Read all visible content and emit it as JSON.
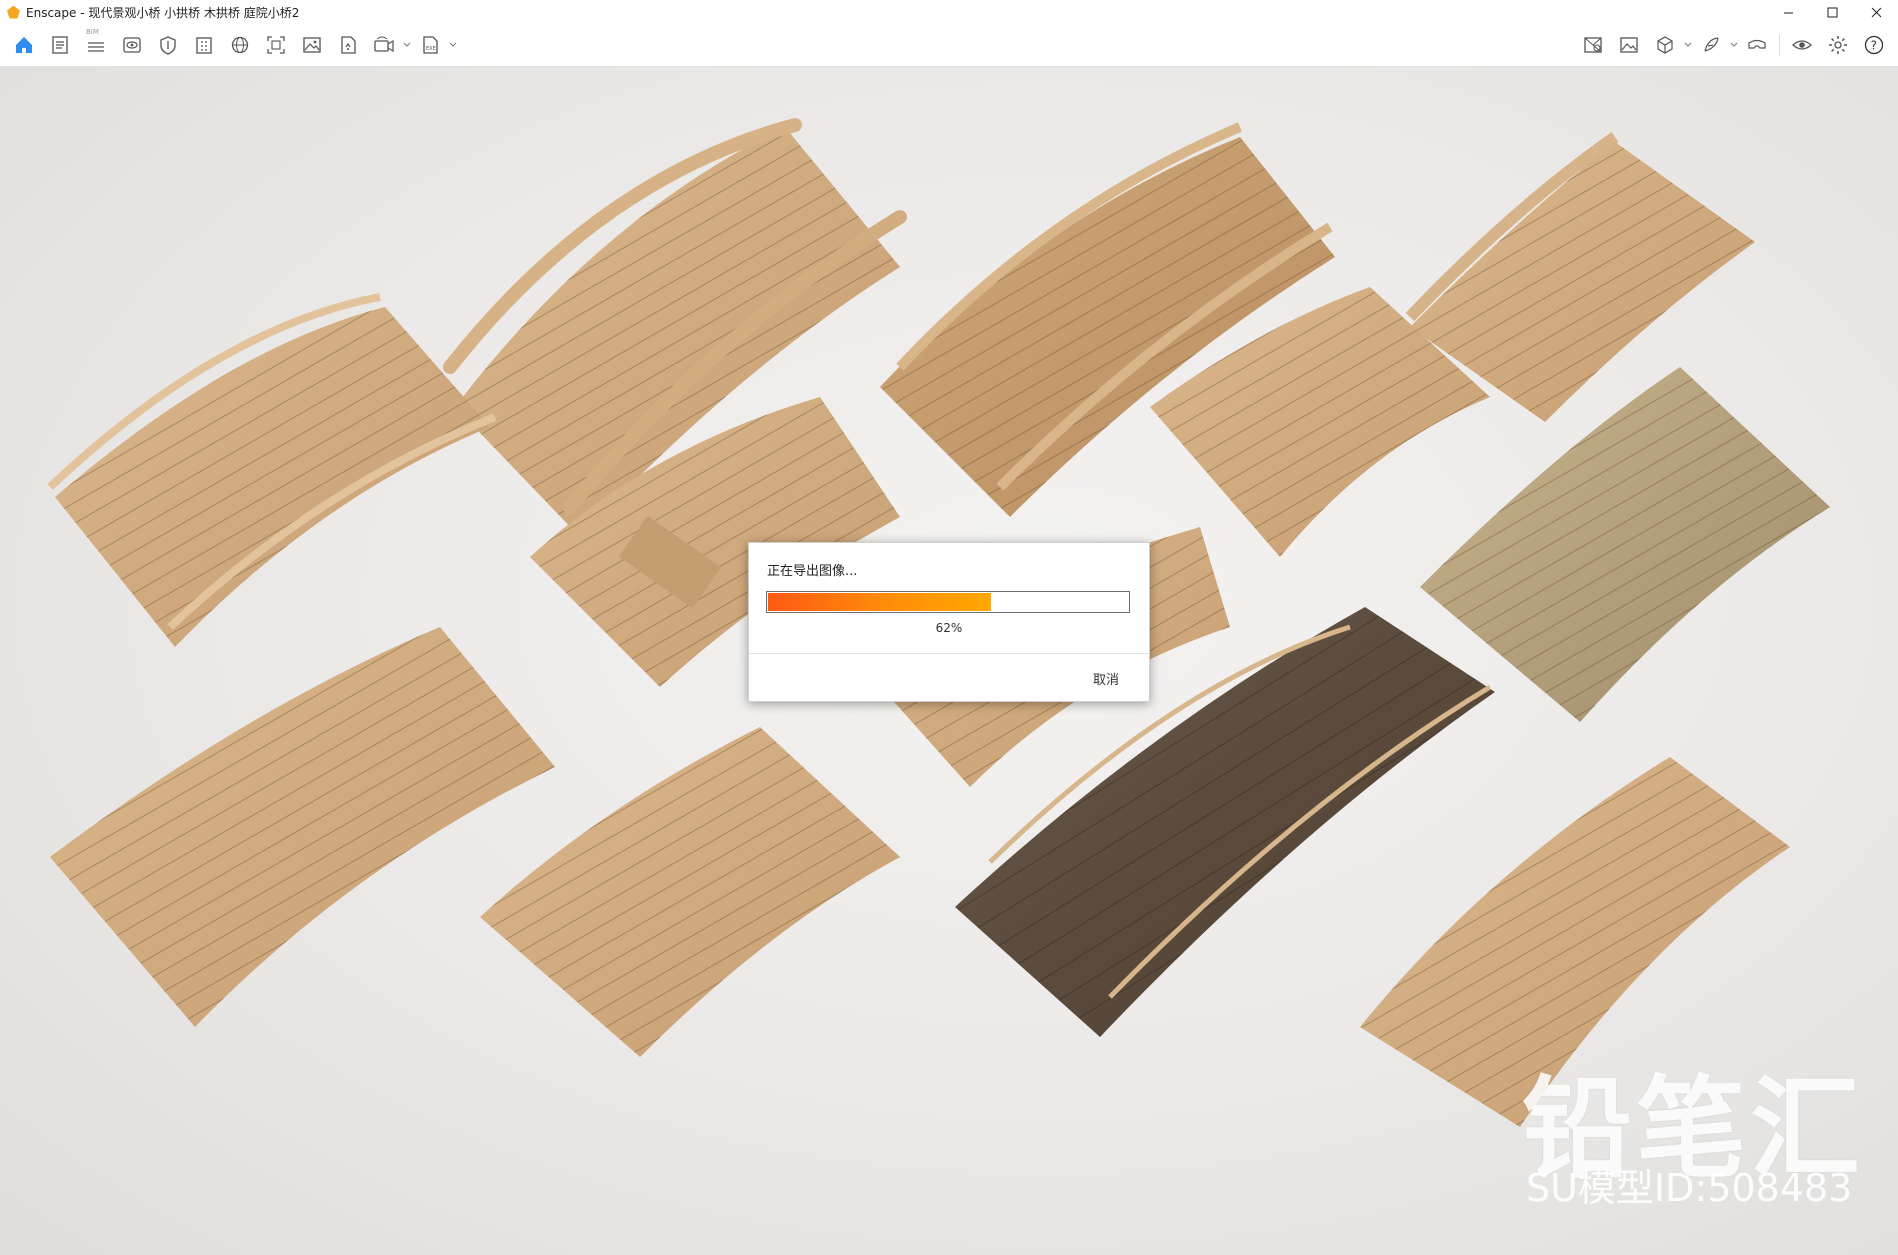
{
  "window": {
    "app_name": "Enscape",
    "title": "Enscape - 现代景观小桥 小拱桥 木拱桥 庭院小桥2",
    "minimize_icon": "minimize-icon",
    "maximize_icon": "maximize-icon",
    "close_icon": "close-icon"
  },
  "toolbar": {
    "left_tools": [
      {
        "name": "home",
        "icon": "home-icon"
      },
      {
        "name": "views-manager",
        "icon": "document-list-icon"
      },
      {
        "name": "bim",
        "icon": "bim-icon",
        "label": "BIM"
      },
      {
        "name": "visual-settings",
        "icon": "eye-panel-icon"
      },
      {
        "name": "asset-library",
        "icon": "shield-asset-icon"
      },
      {
        "name": "material-editor",
        "icon": "building-icon"
      },
      {
        "name": "panorama",
        "icon": "panorama-sphere-icon"
      },
      {
        "name": "screenshot",
        "icon": "screenshot-icon"
      },
      {
        "name": "batch-render",
        "icon": "image-gallery-icon"
      },
      {
        "name": "export-file",
        "icon": "export-file-icon"
      },
      {
        "name": "video",
        "icon": "video-360-icon"
      },
      {
        "name": "exe-export",
        "icon": "exe-export-icon"
      }
    ],
    "right_tools": [
      {
        "name": "sync-views",
        "icon": "map-sync-icon"
      },
      {
        "name": "render-image",
        "icon": "render-image-icon"
      },
      {
        "name": "cube-view",
        "icon": "cube-icon"
      },
      {
        "name": "feedback",
        "icon": "feather-icon"
      },
      {
        "name": "vr-headset",
        "icon": "vr-headset-icon"
      },
      {
        "name": "visibility",
        "icon": "eye-icon"
      },
      {
        "name": "settings",
        "icon": "gear-icon"
      },
      {
        "name": "help",
        "icon": "help-icon"
      }
    ],
    "collapse_icon": "chevron-up-icon"
  },
  "dialog": {
    "message": "正在导出图像...",
    "progress": 0.62,
    "progress_text": "62%",
    "cancel_label": "取消",
    "accent": "#ff7a10"
  },
  "watermark": {
    "brand": "铅笔汇",
    "model_id": "SU模型ID:508483"
  }
}
